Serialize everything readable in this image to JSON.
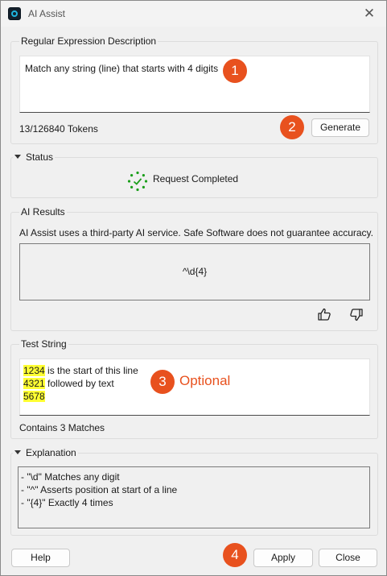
{
  "window": {
    "title": "AI Assist"
  },
  "regex_description": {
    "group_label": "Regular Expression Description",
    "value": "Match any string (line) that starts with 4 digits",
    "token_count": "13/126840 Tokens",
    "generate_label": "Generate"
  },
  "status": {
    "group_label": "Status",
    "message": "Request Completed"
  },
  "ai_results": {
    "group_label": "AI Results",
    "disclaimer": "AI Assist uses a third-party AI service. Safe Software does not guarantee accuracy.",
    "result": "^\\d{4}"
  },
  "test_string": {
    "group_label": "Test String",
    "lines": [
      {
        "match": "1234",
        "rest": " is the start of this line"
      },
      {
        "match": "4321",
        "rest": " followed by text"
      },
      {
        "match": "5678",
        "rest": ""
      }
    ],
    "match_summary": "Contains 3 Matches",
    "optional_label": "Optional"
  },
  "explanation": {
    "group_label": "Explanation",
    "lines": [
      "- \"\\d\" Matches any digit",
      "- \"^\" Asserts position at start of a line",
      "- \"{4}\" Exactly 4 times"
    ]
  },
  "footer": {
    "help_label": "Help",
    "apply_label": "Apply",
    "close_label": "Close"
  },
  "badges": [
    "1",
    "2",
    "3",
    "4"
  ],
  "colors": {
    "badge": "#e8511e",
    "optional_text": "#e8511e",
    "match_highlight": "#ffff33",
    "status_spinner": "#1a9e1a"
  },
  "icons": {
    "close": "close-icon",
    "status": "status-check-icon",
    "thumbs_up": "thumbs-up-icon",
    "thumbs_down": "thumbs-down-icon",
    "collapse": "triangle-down-icon"
  }
}
